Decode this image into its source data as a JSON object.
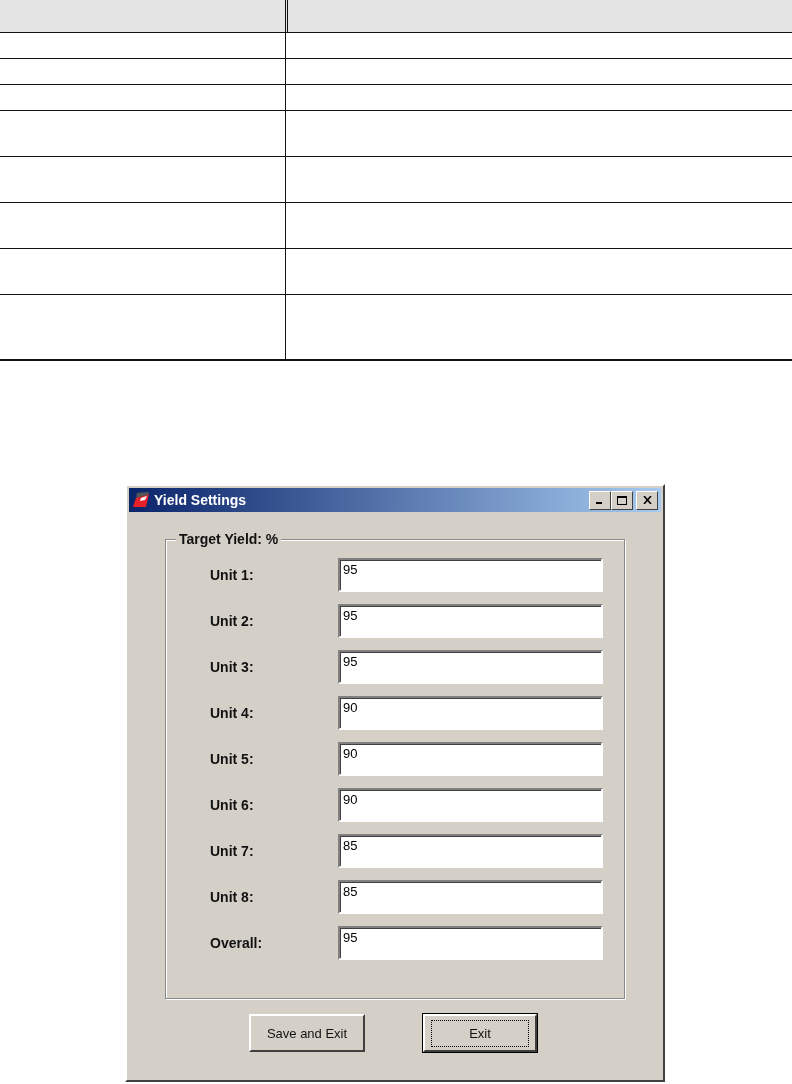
{
  "table": {
    "rows": [
      {
        "kind": "short"
      },
      {
        "kind": "short"
      },
      {
        "kind": "short"
      },
      {
        "kind": "tall"
      },
      {
        "kind": "tall"
      },
      {
        "kind": "tall"
      },
      {
        "kind": "tall"
      },
      {
        "kind": "taller"
      }
    ]
  },
  "window": {
    "title": "Yield Settings"
  },
  "group": {
    "title": "Target Yield: %"
  },
  "fields": [
    {
      "label": "Unit 1:",
      "value": "95"
    },
    {
      "label": "Unit 2:",
      "value": "95"
    },
    {
      "label": "Unit 3:",
      "value": "95"
    },
    {
      "label": "Unit 4:",
      "value": "90"
    },
    {
      "label": "Unit 5:",
      "value": "90"
    },
    {
      "label": "Unit 6:",
      "value": "90"
    },
    {
      "label": "Unit 7:",
      "value": "85"
    },
    {
      "label": "Unit 8:",
      "value": "85"
    },
    {
      "label": "Overall:",
      "value": "95"
    }
  ],
  "buttons": [
    {
      "label": "Save and Exit",
      "default": false
    },
    {
      "label": "Exit",
      "default": true
    }
  ]
}
